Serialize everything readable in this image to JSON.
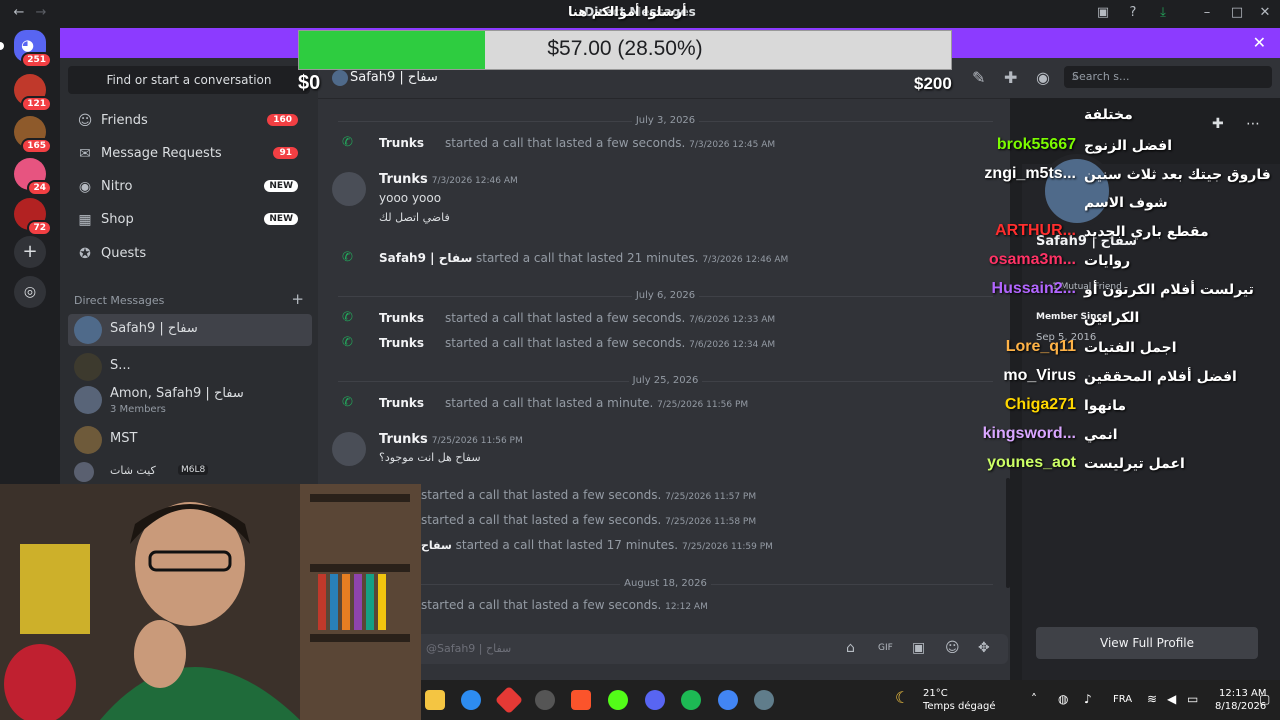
{
  "window": {
    "title": "Direct Messages",
    "overlay_title": "أرسلوا أموالكم هنا"
  },
  "servers": [
    {
      "badge": "251",
      "color": "#5865f2"
    },
    {
      "badge": "121",
      "color": "#c0392b"
    },
    {
      "badge": "165",
      "color": "#8e5a2b"
    },
    {
      "badge": "24",
      "color": "#e75480"
    },
    {
      "badge": "72",
      "color": "#b22222"
    }
  ],
  "donation": {
    "progress_text": "$57.00 (28.50%)",
    "progress": 0.285,
    "min": "$0",
    "max": "$200"
  },
  "sidebar": {
    "find_button": "Find or start a conversation",
    "nav": [
      {
        "label": "Friends",
        "count": "160"
      },
      {
        "label": "Message Requests",
        "count": "91"
      },
      {
        "label": "Nitro",
        "tag": "NEW"
      },
      {
        "label": "Shop",
        "tag": "NEW"
      },
      {
        "label": "Quests"
      }
    ],
    "dm_header": "Direct Messages",
    "dms": [
      {
        "name": "Safah9 | سفاح"
      },
      {
        "name": "S..."
      },
      {
        "name": "Amon, Safah9 | سفاح",
        "sub": "3 Members"
      },
      {
        "name": "MST"
      },
      {
        "name": "كيت شات",
        "sub": "M6L8"
      }
    ]
  },
  "chat": {
    "channel_name": "Safah9 | سفاح",
    "dates": [
      "July 3, 2026",
      "July 6, 2026",
      "July 25, 2026",
      "August 18, 2026"
    ],
    "items": {
      "c1": {
        "who": "Trunks",
        "text": "started a call that lasted a few seconds.",
        "ts": "7/3/2026 12:45 AM"
      },
      "m1": {
        "author": "Trunks",
        "time": "7/3/2026 12:46 AM",
        "lines": [
          "yooo yooo",
          "فاضي اتصل لك"
        ]
      },
      "c2": {
        "who": "Safah9 | سفاح",
        "text": "started a call that lasted 21 minutes.",
        "ts": "7/3/2026 12:46 AM"
      },
      "c3": {
        "who": "Trunks",
        "text": "started a call that lasted a few seconds.",
        "ts": "7/6/2026 12:33 AM"
      },
      "c4": {
        "who": "Trunks",
        "text": "started a call that lasted a few seconds.",
        "ts": "7/6/2026 12:34 AM"
      },
      "c5": {
        "who": "Trunks",
        "text": "started a call that lasted a minute.",
        "ts": "7/25/2026 11:56 PM"
      },
      "m2": {
        "author": "Trunks",
        "time": "7/25/2026 11:56 PM",
        "lines": [
          "سفاح هل انت موجود؟"
        ]
      },
      "c6": {
        "text": "started a call that lasted a few seconds.",
        "ts": "7/25/2026 11:57 PM"
      },
      "c7": {
        "text": "started a call that lasted a few seconds.",
        "ts": "7/25/2026 11:58 PM"
      },
      "c8": {
        "who": "سفاح",
        "text": "started a call that lasted 17 minutes.",
        "ts": "7/25/2026 11:59 PM"
      },
      "c9": {
        "text": "started a call that lasted a few seconds.",
        "ts": "12:12 AM"
      }
    },
    "composer_placeholder": "@Safah9 | سفاح"
  },
  "toolbar": {
    "search_placeholder": "Search s..."
  },
  "profile": {
    "name": "Safah9 | سفاح",
    "mutual": "1 Mutual Friend",
    "member_since_label": "Member Since",
    "member_since": "Sep 5, 2016",
    "view_full_profile": "View Full Profile"
  },
  "stream_chat": {
    "title": "مختلفة",
    "messages": [
      {
        "user": "brok55667",
        "text": "افضل الزنوج",
        "color": "#7cfc00"
      },
      {
        "user": "zngi_m5ts...",
        "text": "فاروق جيتك بعد ثلاث سنين",
        "color": "#ffffff"
      },
      {
        "user": "",
        "text": "شوف الاسم",
        "color": "#ffffff"
      },
      {
        "user": "ARTHUR...",
        "text": "مقطع باري الجديد",
        "color": "#ff2e2e"
      },
      {
        "user": "osama3m...",
        "text": "روايات",
        "color": "#ff3366"
      },
      {
        "user": "Hussain2...",
        "text": "تيرلست أفلام الكرتون أو",
        "color": "#b266ff"
      },
      {
        "user": "",
        "text": "الكراتين",
        "color": "#ffffff"
      },
      {
        "user": "Lore_q11",
        "text": "اجمل الفتيات",
        "color": "#ffb347"
      },
      {
        "user": "mo_Virus",
        "text": "افضل أفلام المحققين",
        "color": "#ffffff"
      },
      {
        "user": "Chiga271",
        "text": "مانهوا",
        "color": "#ffd700"
      },
      {
        "user": "kingsword...",
        "text": "انمي",
        "color": "#d9a6ff"
      },
      {
        "user": "younes_aot",
        "text": "اعمل تيرليست",
        "color": "#ccff66"
      }
    ]
  },
  "taskbar": {
    "temp": "21°C",
    "weather": "Temps dégagé",
    "lang": "FRA",
    "time": "12:13 AM",
    "date": "8/18/2026"
  },
  "colors": {
    "accent": "#5865f2",
    "promo": "#8c3bff",
    "progress": "#2ecc40",
    "call": "#23a55a"
  }
}
